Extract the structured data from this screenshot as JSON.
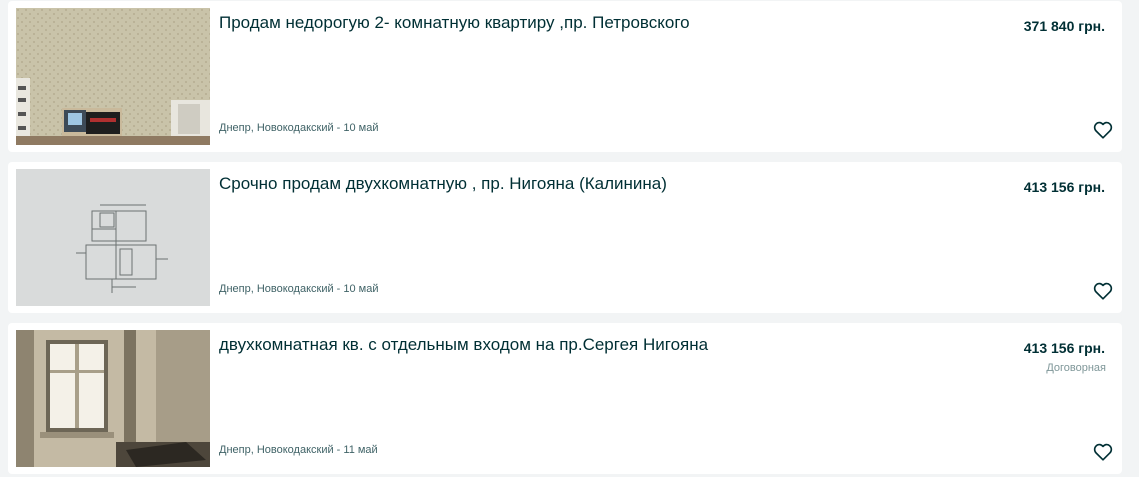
{
  "listings": [
    {
      "title": "Продам недорогую 2- комнатную квартиру ,пр. Петровского",
      "location_date": "Днепр, Новокодакский - 10 май",
      "price": "371 840 грн.",
      "negotiable": ""
    },
    {
      "title": "Срочно продам двухкомнатную , пр. Нигояна (Калинина)",
      "location_date": "Днепр, Новокодакский - 10 май",
      "price": "413 156 грн.",
      "negotiable": ""
    },
    {
      "title": "двухкомнатная кв. с отдельным входом на пр.Сергея Нигояна",
      "location_date": "Днепр, Новокодакский - 11 май",
      "price": "413 156 грн.",
      "negotiable": "Договорная"
    }
  ],
  "icons": {
    "favorite": "heart-outline-icon"
  },
  "colors": {
    "page_background": "#f2f4f5",
    "card_background": "#ffffff",
    "title_text": "#002f34",
    "meta_text": "#406367",
    "negotiable_text": "#7f9799"
  }
}
